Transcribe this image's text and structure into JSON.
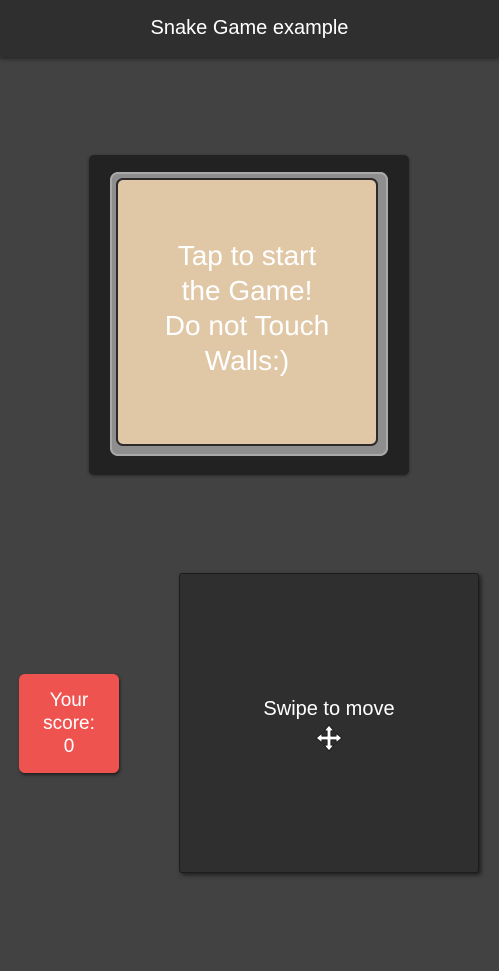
{
  "app_bar": {
    "title": "Snake Game example"
  },
  "game_board": {
    "start_message": "Tap to start\nthe Game!\nDo not Touch\nWalls:)"
  },
  "score": {
    "label": "Your\nscore:",
    "value": "0"
  },
  "controls": {
    "swipe_hint": "Swipe to move",
    "icon": "move-cursor-icon"
  },
  "colors": {
    "background": "#424242",
    "app_bar": "#2f2f2f",
    "board_screen": "#e0c7a6",
    "score_card": "#ef5350",
    "swipe_pad": "#2f2f2f"
  }
}
